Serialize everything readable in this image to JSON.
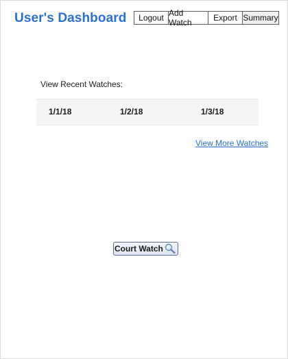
{
  "header": {
    "title": "User's Dashboard",
    "accent_color": "#2a6fd6"
  },
  "nav": {
    "items": [
      {
        "label": "Logout"
      },
      {
        "label": "Add Watch"
      },
      {
        "label": "Export"
      },
      {
        "label": "Summary"
      }
    ]
  },
  "recent": {
    "label": "View Recent Watches:",
    "dates": [
      "1/1/18",
      "1/2/18",
      "1/3/18"
    ],
    "more_link": "View More Watches"
  },
  "court_watch": {
    "label": "Court Watch",
    "icon": "magnifier-icon"
  }
}
